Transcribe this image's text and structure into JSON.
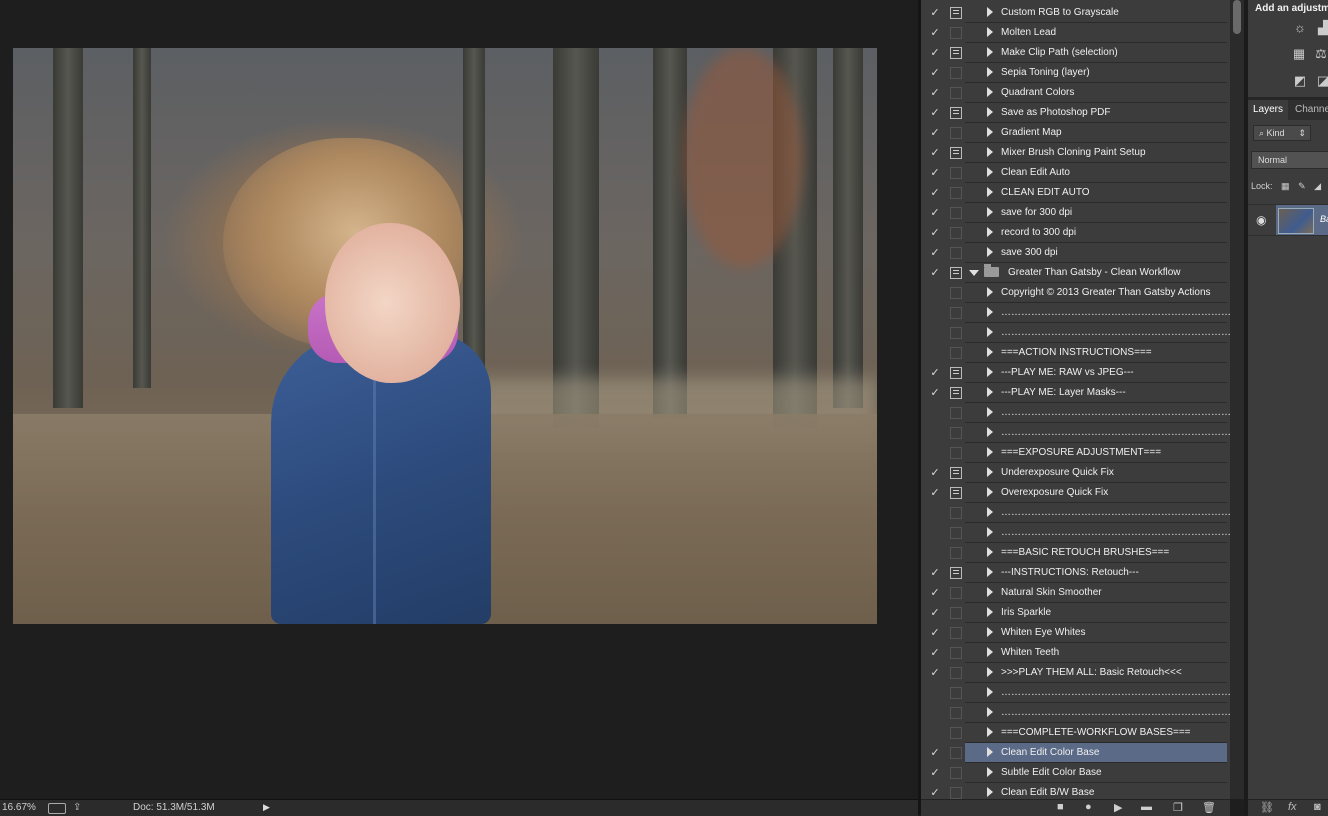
{
  "status_bar": {
    "zoom": "16.67%",
    "doc_size": "Doc: 51.3M/51.3M"
  },
  "actions": [
    {
      "label": "Custom RGB to Grayscale",
      "checked": true,
      "dialog": true
    },
    {
      "label": "Molten Lead",
      "checked": true,
      "dialog": false
    },
    {
      "label": "Make Clip Path (selection)",
      "checked": true,
      "dialog": true
    },
    {
      "label": "Sepia Toning (layer)",
      "checked": true,
      "dialog": false
    },
    {
      "label": "Quadrant Colors",
      "checked": true,
      "dialog": false
    },
    {
      "label": "Save as Photoshop PDF",
      "checked": true,
      "dialog": true
    },
    {
      "label": "Gradient Map",
      "checked": true,
      "dialog": false
    },
    {
      "label": "Mixer Brush Cloning Paint Setup",
      "checked": true,
      "dialog": true
    },
    {
      "label": "Clean Edit Auto",
      "checked": true,
      "dialog": false
    },
    {
      "label": "CLEAN EDIT AUTO",
      "checked": true,
      "dialog": false
    },
    {
      "label": "save for 300 dpi",
      "checked": true,
      "dialog": false
    },
    {
      "label": "record to 300 dpi",
      "checked": true,
      "dialog": false
    },
    {
      "label": "save 300 dpi",
      "checked": true,
      "dialog": false
    },
    {
      "label": "Greater Than Gatsby - Clean Workflow",
      "checked": true,
      "dialog": true,
      "set": true
    },
    {
      "label": "Copyright © 2013 Greater Than Gatsby Actions",
      "checked": false,
      "dialog": false
    },
    {
      "label": "……………………………………………………………",
      "checked": false,
      "dialog": false
    },
    {
      "label": "……………………………………………………………",
      "checked": false,
      "dialog": false
    },
    {
      "label": "===ACTION INSTRUCTIONS===",
      "checked": false,
      "dialog": false
    },
    {
      "label": "---PLAY ME: RAW vs JPEG---",
      "checked": true,
      "dialog": true
    },
    {
      "label": "---PLAY ME: Layer Masks---",
      "checked": true,
      "dialog": true
    },
    {
      "label": "……………………………………………………………",
      "checked": false,
      "dialog": false
    },
    {
      "label": "……………………………………………………………",
      "checked": false,
      "dialog": false
    },
    {
      "label": "===EXPOSURE ADJUSTMENT===",
      "checked": false,
      "dialog": false
    },
    {
      "label": "Underexposure Quick Fix",
      "checked": true,
      "dialog": true
    },
    {
      "label": "Overexposure Quick Fix",
      "checked": true,
      "dialog": true
    },
    {
      "label": "……………………………………………………………",
      "checked": false,
      "dialog": false
    },
    {
      "label": "……………………………………………………………",
      "checked": false,
      "dialog": false
    },
    {
      "label": "===BASIC RETOUCH BRUSHES===",
      "checked": false,
      "dialog": false
    },
    {
      "label": "---INSTRUCTIONS: Retouch---",
      "checked": true,
      "dialog": true
    },
    {
      "label": "Natural Skin Smoother",
      "checked": true,
      "dialog": false
    },
    {
      "label": "Iris Sparkle",
      "checked": true,
      "dialog": false
    },
    {
      "label": "Whiten Eye Whites",
      "checked": true,
      "dialog": false
    },
    {
      "label": "Whiten Teeth",
      "checked": true,
      "dialog": false
    },
    {
      "label": ">>>PLAY THEM ALL: Basic Retouch<<<",
      "checked": true,
      "dialog": false
    },
    {
      "label": "……………………………………………………………",
      "checked": false,
      "dialog": false
    },
    {
      "label": "……………………………………………………………",
      "checked": false,
      "dialog": false
    },
    {
      "label": "===COMPLETE-WORKFLOW BASES===",
      "checked": false,
      "dialog": false
    },
    {
      "label": "Clean Edit Color Base",
      "checked": true,
      "dialog": false,
      "selected": true
    },
    {
      "label": "Subtle Edit Color Base",
      "checked": true,
      "dialog": false
    },
    {
      "label": "Clean Edit B/W Base",
      "checked": true,
      "dialog": false
    }
  ],
  "adjustments": {
    "title": "Add an adjustm"
  },
  "layers": {
    "tab_layers": "Layers",
    "tab_channels": "Channe",
    "kind_label": "⌕ Kind",
    "blend_mode": "Normal",
    "lock_label": "Lock:",
    "layer_name": "Ba"
  },
  "icons": {
    "check": "✓",
    "eye": "👁"
  },
  "colors": {
    "selection": "#5b6a86",
    "panel_bg": "#3c3c3c",
    "canvas_bg": "#1e1e1e"
  }
}
